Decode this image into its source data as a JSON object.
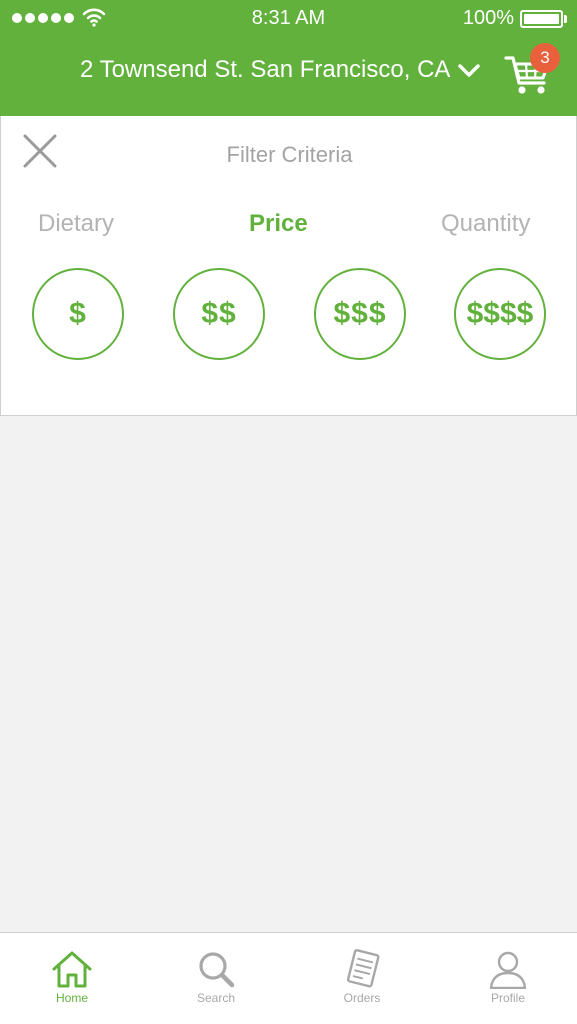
{
  "status_bar": {
    "time": "8:31 AM",
    "battery": "100%"
  },
  "header": {
    "location": "2 Townsend St. San Francisco, CA",
    "cart_count": "3"
  },
  "filter": {
    "title": "Filter Criteria",
    "tabs": [
      {
        "label": "Dietary",
        "active": false
      },
      {
        "label": "Price",
        "active": true
      },
      {
        "label": "Quantity",
        "active": false
      }
    ],
    "price_options": [
      "$",
      "$$",
      "$$$",
      "$$$$"
    ]
  },
  "tab_bar": {
    "items": [
      {
        "label": "Home",
        "icon": "home-icon",
        "active": true
      },
      {
        "label": "Search",
        "icon": "search-icon",
        "active": false
      },
      {
        "label": "Orders",
        "icon": "receipt-icon",
        "active": false
      },
      {
        "label": "Profile",
        "icon": "user-icon",
        "active": false
      }
    ]
  },
  "colors": {
    "brand_green": "#62b13d",
    "badge_red": "#e8603c",
    "inactive_gray": "#a8a8a8"
  }
}
